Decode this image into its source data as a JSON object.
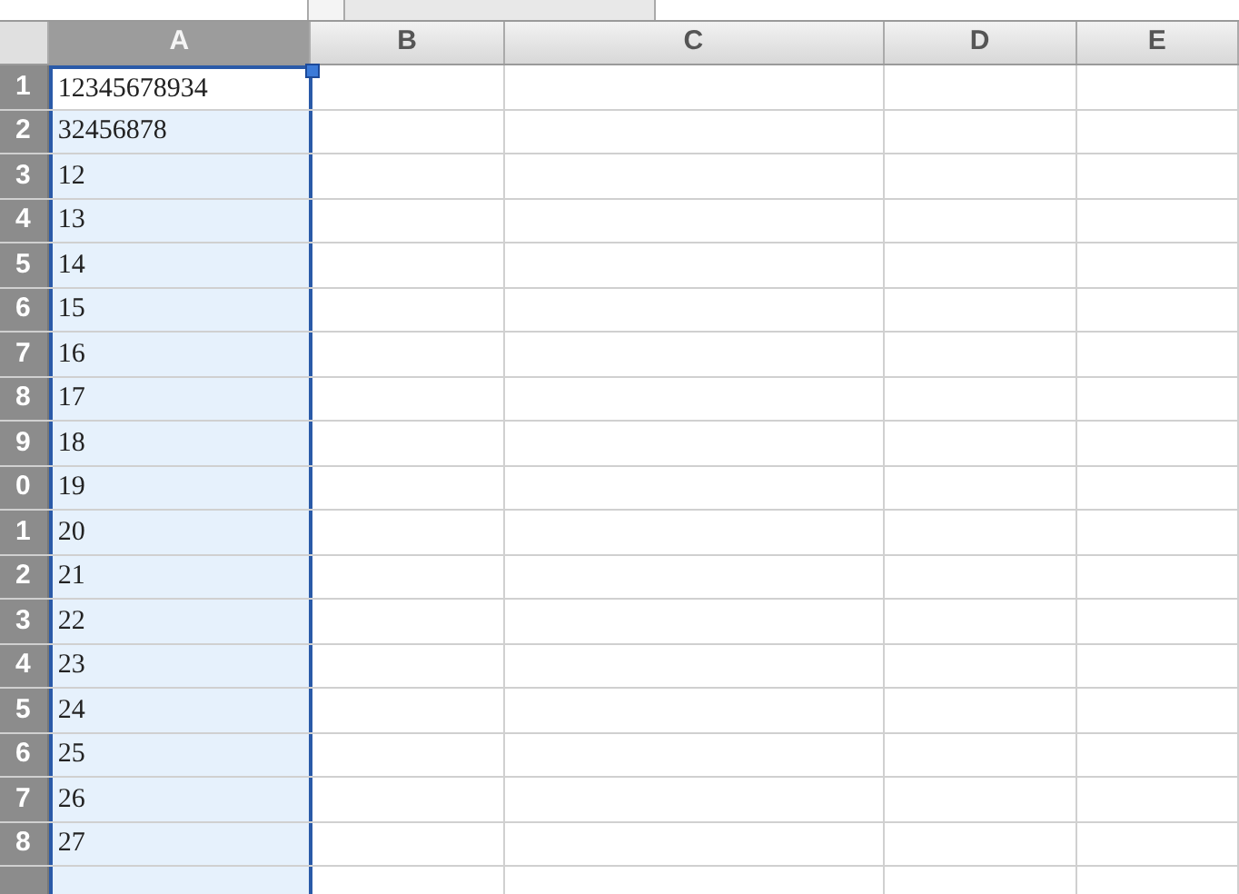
{
  "columns": [
    {
      "label": "A",
      "selected": true
    },
    {
      "label": "B",
      "selected": false
    },
    {
      "label": "C",
      "selected": false
    },
    {
      "label": "D",
      "selected": false
    },
    {
      "label": "E",
      "selected": false
    }
  ],
  "rows": [
    {
      "header": "1",
      "value": "12345678934",
      "active": true
    },
    {
      "header": "2",
      "value": "32456878",
      "active": false
    },
    {
      "header": "3",
      "value": "12",
      "active": false
    },
    {
      "header": "4",
      "value": "13",
      "active": false
    },
    {
      "header": "5",
      "value": "14",
      "active": false
    },
    {
      "header": "6",
      "value": "15",
      "active": false
    },
    {
      "header": "7",
      "value": "16",
      "active": false
    },
    {
      "header": "8",
      "value": "17",
      "active": false
    },
    {
      "header": "9",
      "value": "18",
      "active": false
    },
    {
      "header": "0",
      "value": "19",
      "active": false
    },
    {
      "header": "1",
      "value": "20",
      "active": false
    },
    {
      "header": "2",
      "value": "21",
      "active": false
    },
    {
      "header": "3",
      "value": "22",
      "active": false
    },
    {
      "header": "4",
      "value": "23",
      "active": false
    },
    {
      "header": "5",
      "value": "24",
      "active": false
    },
    {
      "header": "6",
      "value": "25",
      "active": false
    },
    {
      "header": "7",
      "value": "26",
      "active": false
    },
    {
      "header": "8",
      "value": "27",
      "active": false
    },
    {
      "active": false
    }
  ]
}
